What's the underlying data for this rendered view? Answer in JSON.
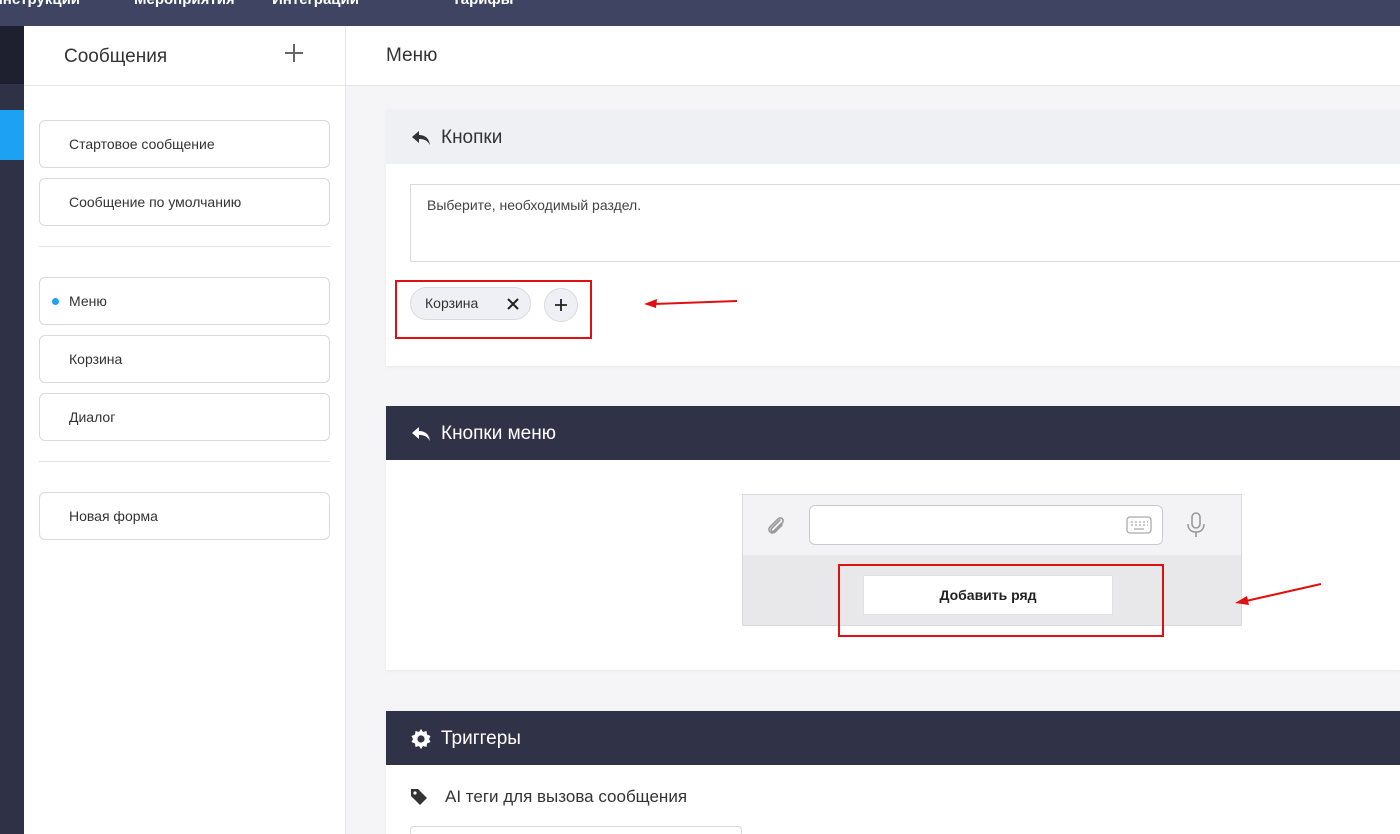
{
  "top_nav": {
    "items": [
      "Инструкции",
      "Мероприятия",
      "Интеграции",
      "Тарифы"
    ]
  },
  "messages_panel": {
    "title": "Сообщения",
    "add_icon": "plus-icon",
    "fixed_items": [
      "Стартовое сообщение",
      "Сообщение по умолчанию"
    ],
    "custom_items": [
      "Меню",
      "Корзина",
      "Диалог"
    ],
    "active_item": "Меню",
    "form_items": [
      "Новая форма"
    ]
  },
  "main": {
    "title": "Меню",
    "buttons_card": {
      "title": "Кнопки",
      "icon": "reply-icon",
      "message_text": "Выберите, необходимый раздел.",
      "chips": [
        "Корзина"
      ],
      "add_icon": "plus-icon"
    },
    "menu_buttons_card": {
      "title": "Кнопки меню",
      "icon": "reply-icon",
      "add_row_label": "Добавить ряд"
    },
    "triggers_card": {
      "title": "Триггеры",
      "icon": "gear-icon",
      "ai_tags_label": "AI теги для вызова сообщения"
    }
  },
  "colors": {
    "accent": "#1da1f2",
    "header_dark": "#303348",
    "annotation_red": "#e01010"
  }
}
